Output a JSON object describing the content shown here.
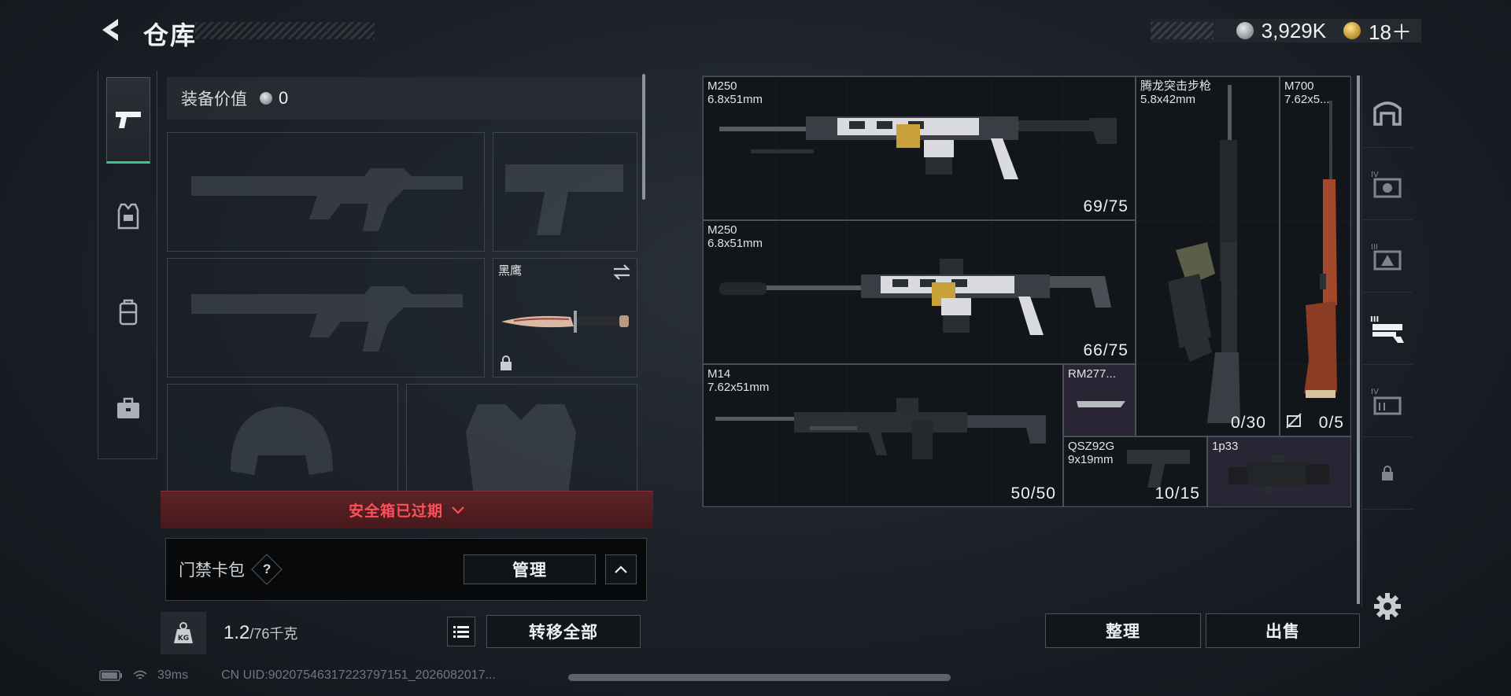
{
  "header": {
    "title": "仓库",
    "currency": [
      {
        "icon": "silver-coin-icon",
        "value": "3,929K"
      },
      {
        "icon": "gold-coin-icon",
        "value": "18＋"
      }
    ]
  },
  "side_tabs": [
    {
      "name": "pistol-icon",
      "active": true
    },
    {
      "name": "armor-vest-icon",
      "active": false
    },
    {
      "name": "backpack-icon",
      "active": false
    },
    {
      "name": "briefcase-icon",
      "active": false
    }
  ],
  "loadout": {
    "equip_value_label": "装备价值",
    "equip_value": "0",
    "melee_slot_name": "黑鹰",
    "safebox_expired": "安全箱已过期",
    "keycard_label": "门禁卡包",
    "help_mark": "?",
    "manage_button": "管理",
    "weight_current": "1.2",
    "weight_max": "/76千克",
    "transfer_all_button": "转移全部",
    "weight_badge": "KG"
  },
  "warehouse": {
    "items": [
      {
        "name": "M250\n6.8x51mm",
        "count": "69/75"
      },
      {
        "name": "M250\n6.8x51mm",
        "count": "66/75"
      },
      {
        "name": "M14\n7.62x51mm",
        "count": "50/50"
      },
      {
        "name": "腾龙突击步枪\n5.8x42mm",
        "count": "0/30"
      },
      {
        "name": "M700\n7.62x5...",
        "count": "0/5"
      },
      {
        "name": "RM277...",
        "count": ""
      },
      {
        "name": "QSZ92G\n9x19mm",
        "count": "10/15"
      },
      {
        "name": "1p33",
        "count": ""
      }
    ],
    "sort_button": "整理",
    "sell_button": "出售"
  },
  "rail": [
    {
      "name": "safe-house-icon"
    },
    {
      "name": "armor-tier-4-icon",
      "tier": "IV"
    },
    {
      "name": "armor-tier-3-icon",
      "tier": "III"
    },
    {
      "name": "weapon-rack-tier-3-icon",
      "tier": "III"
    },
    {
      "name": "storage-tier-4-icon",
      "tier": "IV"
    },
    {
      "name": "lock-icon"
    },
    {
      "name": "gear-icon"
    }
  ],
  "status": {
    "ping": "39ms",
    "uid": "CN UID:90207546317223797151_2026082017..."
  },
  "colors": {
    "accent_green": "#36c98a",
    "alert_red": "#ff4f5a",
    "panel_bg": "#0f1216"
  }
}
